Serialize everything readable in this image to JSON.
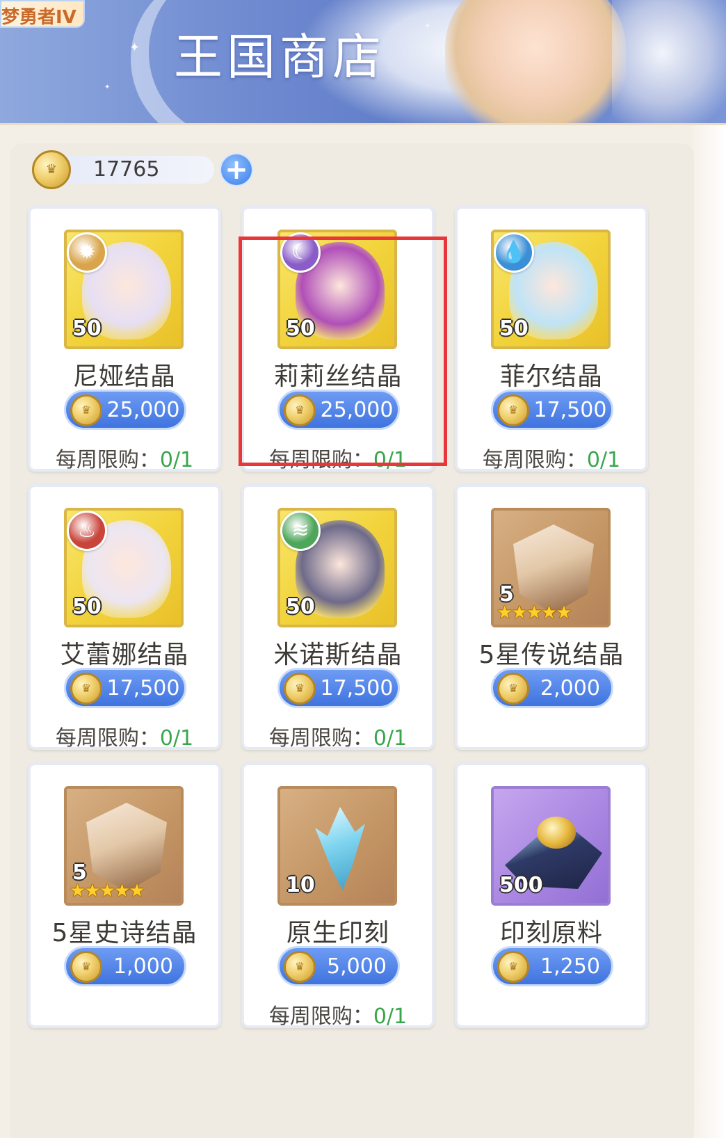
{
  "app": {
    "corner_tag": "梦勇者IV",
    "title": "王国商店"
  },
  "currency": {
    "amount": "17765",
    "icon": "crown-coin-icon",
    "add_icon": "plus-icon"
  },
  "items": [
    {
      "name": "尼娅结晶",
      "qty": "50",
      "price": "25,000",
      "limit_label": "每周限购：",
      "limit_value": "0/1",
      "type": "portrait",
      "element": "sun-gear",
      "element_color": "#d9a44a",
      "portrait_color": "#e6dff4"
    },
    {
      "name": "莉莉丝结晶",
      "qty": "50",
      "price": "25,000",
      "limit_label": "每周限购：",
      "limit_value": "0/1",
      "type": "portrait",
      "element": "moon",
      "element_color": "#8a5cc7",
      "portrait_color": "#b04fb8"
    },
    {
      "name": "菲尔结晶",
      "qty": "50",
      "price": "17,500",
      "limit_label": "每周限购：",
      "limit_value": "0/1",
      "type": "portrait",
      "element": "water-drop",
      "element_color": "#3a8fd6",
      "portrait_color": "#bfe3f6"
    },
    {
      "name": "艾蕾娜结晶",
      "qty": "50",
      "price": "17,500",
      "limit_label": "每周限购：",
      "limit_value": "0/1",
      "type": "portrait",
      "element": "flame",
      "element_color": "#c9443a",
      "portrait_color": "#ece6f2"
    },
    {
      "name": "米诺斯结晶",
      "qty": "50",
      "price": "17,500",
      "limit_label": "每周限购：",
      "limit_value": "0/1",
      "type": "portrait",
      "element": "wind",
      "element_color": "#4ea65a",
      "portrait_color": "#6e6a8a"
    },
    {
      "name": "5星传说结晶",
      "qty": "5",
      "price": "2,000",
      "limit_label": "",
      "limit_value": "",
      "type": "crystal",
      "stars": "★★★★★"
    },
    {
      "name": "5星史诗结晶",
      "qty": "5",
      "price": "1,000",
      "limit_label": "",
      "limit_value": "",
      "type": "crystal",
      "stars": "★★★★★"
    },
    {
      "name": "原生印刻",
      "qty": "10",
      "price": "5,000",
      "limit_label": "每周限购：",
      "limit_value": "0/1",
      "type": "shard"
    },
    {
      "name": "印刻原料",
      "qty": "500",
      "price": "1,250",
      "limit_label": "",
      "limit_value": "",
      "type": "material"
    }
  ],
  "element_glyphs": {
    "sun-gear": "✹",
    "moon": "☾",
    "water-drop": "💧",
    "flame": "♨",
    "wind": "≋"
  },
  "highlighted_item": "莉莉丝结晶"
}
